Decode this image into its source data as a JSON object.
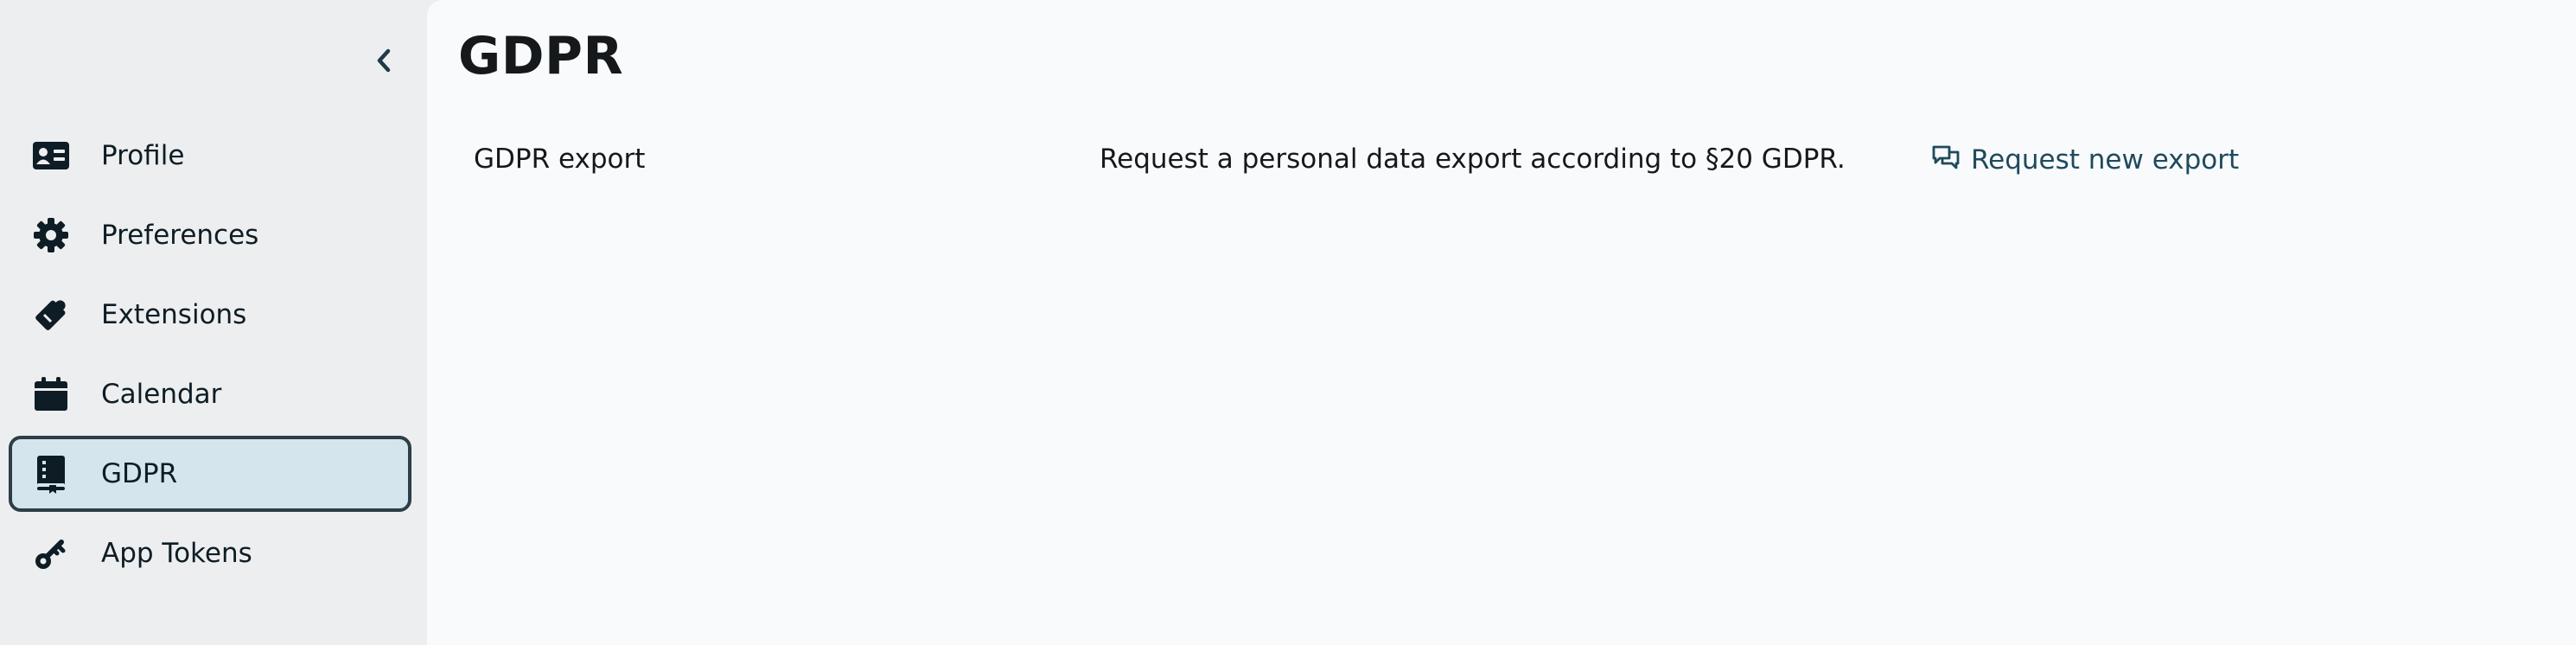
{
  "sidebar": {
    "collapse_icon": "chevron-left-icon",
    "items": [
      {
        "label": "Profile",
        "icon": "id-card-icon",
        "active": false
      },
      {
        "label": "Preferences",
        "icon": "gear-icon",
        "active": false
      },
      {
        "label": "Extensions",
        "icon": "puzzle-icon",
        "active": false
      },
      {
        "label": "Calendar",
        "icon": "calendar-icon",
        "active": false
      },
      {
        "label": "GDPR",
        "icon": "book-icon",
        "active": true
      },
      {
        "label": "App Tokens",
        "icon": "key-icon",
        "active": false
      }
    ]
  },
  "main": {
    "title": "GDPR",
    "rows": [
      {
        "name": "GDPR export",
        "description": "Request a personal data export according to §20 GDPR.",
        "action_label": "Request new export",
        "action_icon": "chat-bubbles-icon"
      }
    ]
  },
  "colors": {
    "sidebar_bg": "#edeef0",
    "main_bg": "#f8fafc",
    "active_bg": "#d5e5ee",
    "active_border": "#2c3e47",
    "text": "#0e1d25",
    "link": "#1f4a5c"
  }
}
